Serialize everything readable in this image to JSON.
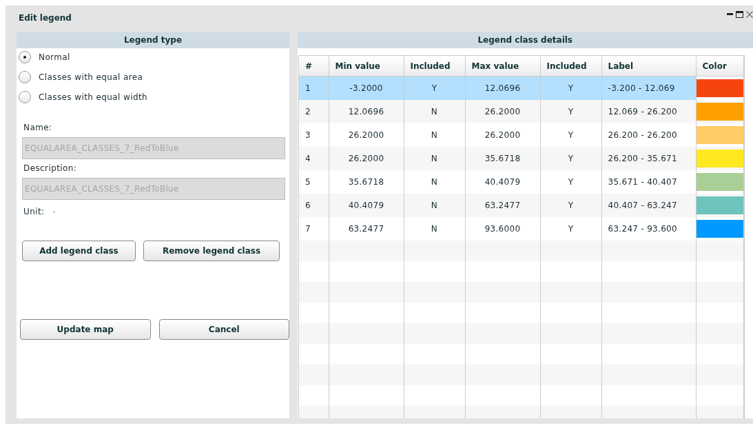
{
  "window": {
    "title": "Edit legend"
  },
  "legend_type": {
    "header": "Legend type",
    "options": [
      {
        "label": "Normal",
        "selected": true
      },
      {
        "label": "Classes with equal area",
        "selected": false
      },
      {
        "label": "Classes with equal width",
        "selected": false
      }
    ],
    "name": {
      "label": "Name:",
      "value": "EQUALAREA_CLASSES_7_RedToBlue",
      "disabled": true
    },
    "description": {
      "label": "Description:",
      "value": "EQUALAREA_CLASSES_7_RedToBlue",
      "disabled": true
    },
    "unit": {
      "label": "Unit:",
      "value": "-"
    },
    "class_buttons": [
      "Add legend class",
      "Remove legend class"
    ],
    "action_buttons": [
      "Update map",
      "Cancel"
    ]
  },
  "details": {
    "header": "Legend class details",
    "columns": [
      "#",
      "Min value",
      "Included",
      "Max value",
      "Included",
      "Label",
      "Color"
    ],
    "rows": [
      {
        "index": "1",
        "min": "-3.2000",
        "min_included": "Y",
        "max": "12.0696",
        "max_included": "Y",
        "label": "-3.200 - 12.069",
        "color": "#f5450f",
        "selected": true
      },
      {
        "index": "2",
        "min": "12.0696",
        "min_included": "N",
        "max": "26.2000",
        "max_included": "Y",
        "label": "12.069 - 26.200",
        "color": "#ffa000",
        "selected": false
      },
      {
        "index": "3",
        "min": "26.2000",
        "min_included": "N",
        "max": "26.2000",
        "max_included": "Y",
        "label": "26.200 - 26.200",
        "color": "#ffcc66",
        "selected": false
      },
      {
        "index": "4",
        "min": "26.2000",
        "min_included": "N",
        "max": "35.6718",
        "max_included": "Y",
        "label": "26.200 - 35.671",
        "color": "#ffe81e",
        "selected": false
      },
      {
        "index": "5",
        "min": "35.6718",
        "min_included": "N",
        "max": "40.4079",
        "max_included": "Y",
        "label": "35.671 - 40.407",
        "color": "#aacf96",
        "selected": false
      },
      {
        "index": "6",
        "min": "40.4079",
        "min_included": "N",
        "max": "63.2477",
        "max_included": "Y",
        "label": "40.407 - 63.247",
        "color": "#6cc4bc",
        "selected": false
      },
      {
        "index": "7",
        "min": "63.2477",
        "min_included": "N",
        "max": "93.6000",
        "max_included": "Y",
        "label": "63.247 - 93.600",
        "color": "#0099ff",
        "selected": false
      }
    ]
  }
}
